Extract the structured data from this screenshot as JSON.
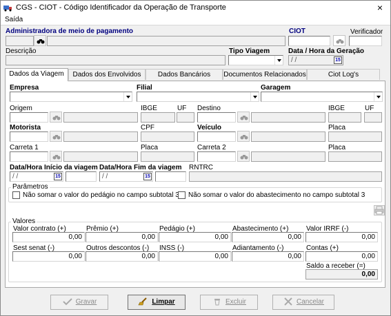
{
  "window": {
    "title": "CGS - CIOT - Código Identificador da Operação de Transporte",
    "close_label": "×"
  },
  "menu": {
    "saida": "Saída"
  },
  "header": {
    "administradora_label": "Administradora de meio de pagamento",
    "ciot_label": "CIOT",
    "verificador_label": "Verificador",
    "descricao_label": "Descrição",
    "tipo_viagem_label": "Tipo Viagem",
    "data_geracao_label": "Data / Hora da Geração",
    "data_geracao_value": "/ /"
  },
  "tabs": [
    "Dados da Viagem",
    "Dados dos Envolvidos",
    "Dados Bancários",
    "Documentos Relacionados",
    "Ciot Log's"
  ],
  "viagem": {
    "empresa_label": "Empresa",
    "filial_label": "Filial",
    "garagem_label": "Garagem",
    "origem_label": "Origem",
    "ibge_label": "IBGE",
    "uf_label": "UF",
    "destino_label": "Destino",
    "ibge2_label": "IBGE",
    "uf2_label": "UF",
    "motorista_label": "Motorista",
    "cpf_label": "CPF",
    "veiculo_label": "Veículo",
    "placa_label": "Placa",
    "carreta1_label": "Carreta 1",
    "placa2_label": "Placa",
    "carreta2_label": "Carreta 2",
    "placa3_label": "Placa",
    "inicio_label": "Data/Hora Início da viagem",
    "fim_label": "Data/Hora Fim da viagem",
    "rntrc_label": "RNTRC",
    "inicio_value": "/ /",
    "fim_value": "/ /"
  },
  "parametros": {
    "title": "Parâmetros",
    "opt1": "Não somar o valor do pedágio no campo subtotal 3",
    "opt2": "Não somar o valor do abastecimento no campo subtotal 3"
  },
  "valores": {
    "title": "Valores",
    "row1": [
      {
        "label": "Valor contrato (+)",
        "value": "0,00"
      },
      {
        "label": "Prêmio (+)",
        "value": "0,00"
      },
      {
        "label": "Pedágio (+)",
        "value": "0,00"
      },
      {
        "label": "Abastecimento (+)",
        "value": "0,00"
      },
      {
        "label": "Valor IRRF (-)",
        "value": "0,00"
      }
    ],
    "row2": [
      {
        "label": "Sest senat (-)",
        "value": "0,00"
      },
      {
        "label": "Outros descontos (-)",
        "value": "0,00"
      },
      {
        "label": "INSS (-)",
        "value": "0,00"
      },
      {
        "label": "Adiantamento (-)",
        "value": "0,00"
      },
      {
        "label": "Contas (+)",
        "value": "0,00"
      }
    ],
    "saldo_label": "Saldo a receber (=)",
    "saldo_value": "0,00"
  },
  "buttons": {
    "gravar": "Gravar",
    "limpar": "Limpar",
    "excluir": "Excluir",
    "cancelar": "Cancelar"
  }
}
